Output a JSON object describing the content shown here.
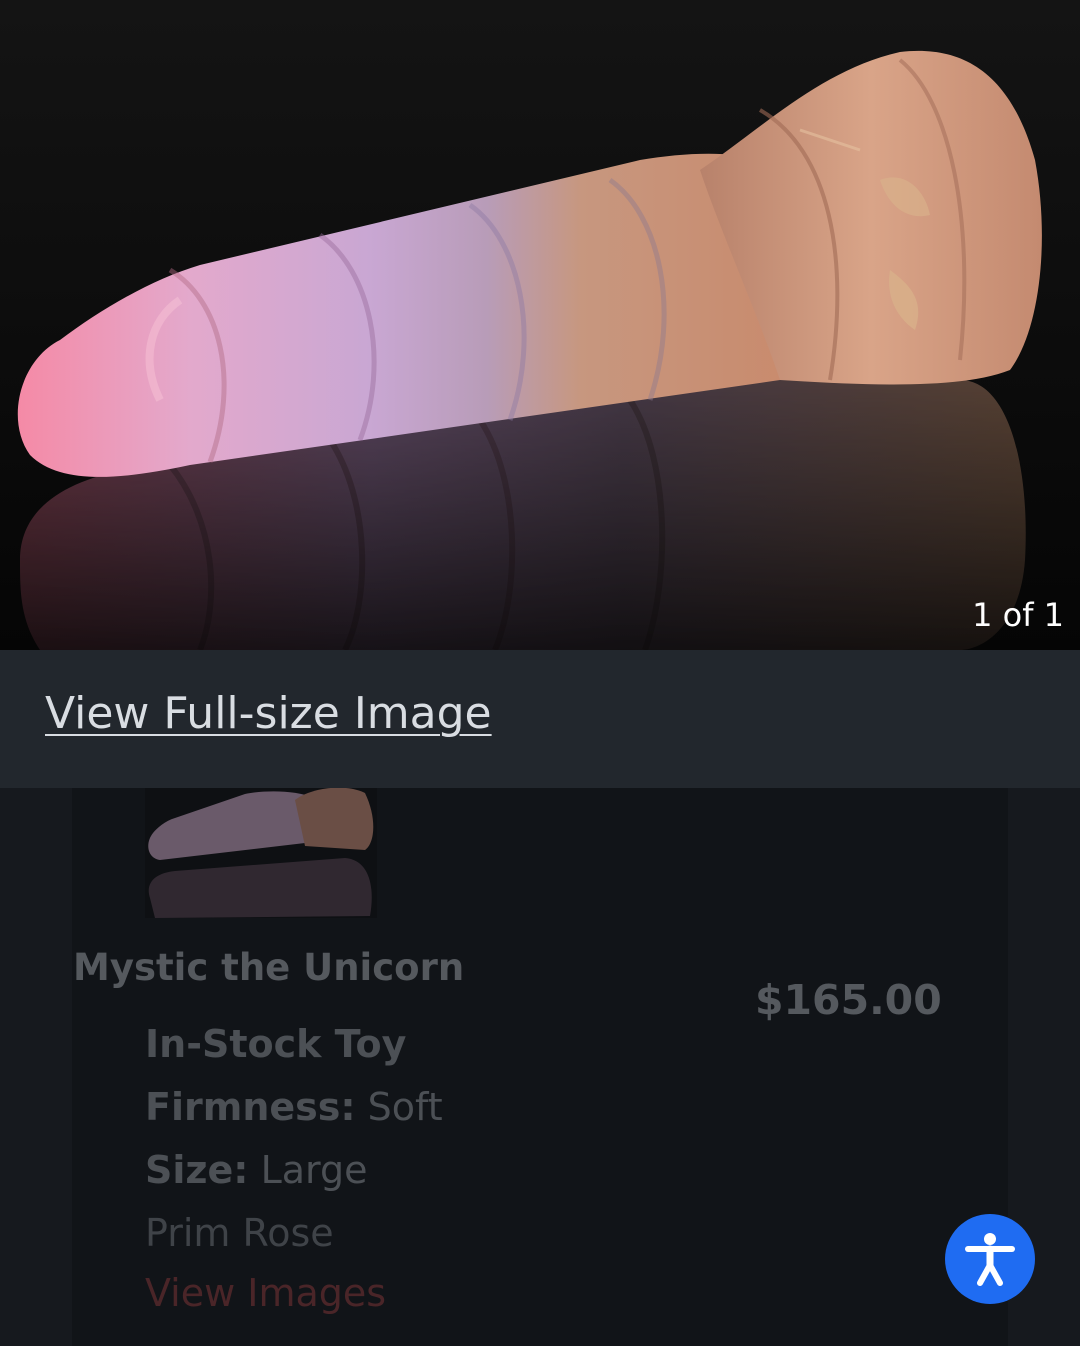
{
  "gallery": {
    "counter": "1 of 1",
    "view_full_size": "View Full-size Image"
  },
  "product": {
    "title": "Mystic the Unicorn",
    "price": "$165.00",
    "stock": "In-Stock Toy",
    "firmness_label": "Firmness:",
    "firmness_value": "Soft",
    "size_label": "Size:",
    "size_value": "Large",
    "color": "Prim Rose",
    "view_images": "View Images"
  },
  "icons": {
    "accessibility": "accessibility-icon"
  },
  "colors": {
    "accessibility_button": "#1f6cf2",
    "view_images_link": "#4a2528"
  }
}
